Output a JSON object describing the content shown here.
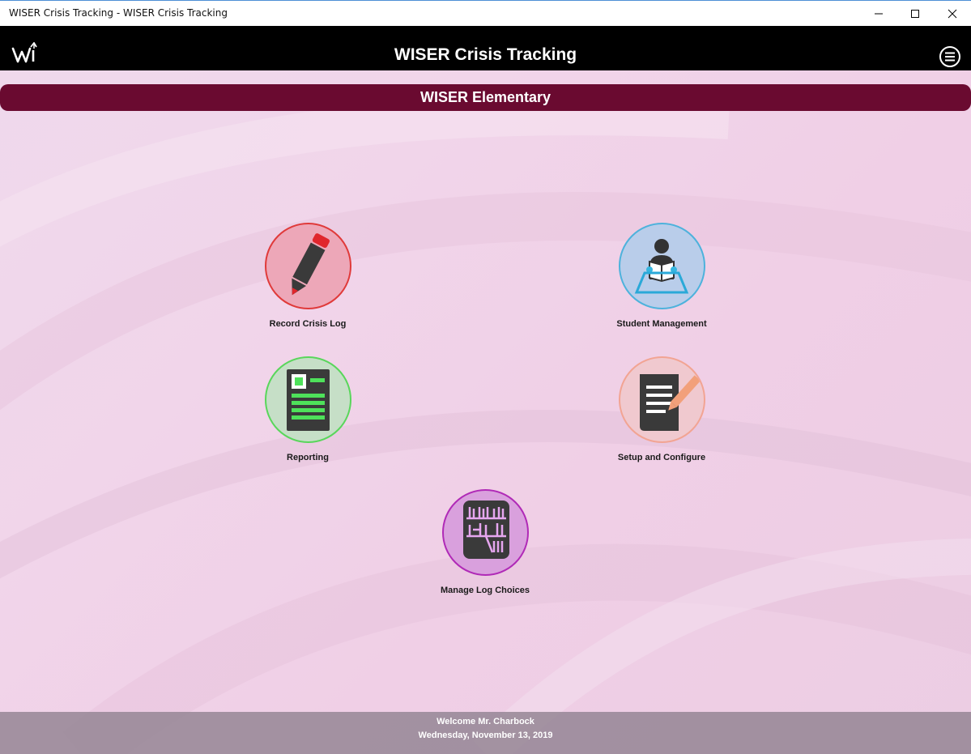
{
  "window": {
    "title": "WISER Crisis Tracking - WISER Crisis Tracking"
  },
  "header": {
    "title": "WISER Crisis Tracking",
    "logo_icon": "wiser-logo-icon",
    "menu_icon": "hamburger-menu-icon"
  },
  "school": {
    "name": "WISER Elementary"
  },
  "tiles": [
    {
      "label": "Record Crisis Log",
      "icon": "pencil-icon",
      "accent": "#e03a3a"
    },
    {
      "label": "Student Management",
      "icon": "student-reading-icon",
      "accent": "#4db2dc"
    },
    {
      "label": "Reporting",
      "icon": "report-document-icon",
      "accent": "#59d65b"
    },
    {
      "label": "Setup and Configure",
      "icon": "document-edit-icon",
      "accent": "#f2a493"
    },
    {
      "label": "Manage Log Choices",
      "icon": "bookshelf-icon",
      "accent": "#b02ab7"
    }
  ],
  "footer": {
    "welcome": "Welcome Mr. Charbock",
    "date": "Wednesday, November 13, 2019"
  },
  "colors": {
    "appbar": "#000000",
    "school_bar": "#6a0a30",
    "background": "#f0d4e9"
  }
}
